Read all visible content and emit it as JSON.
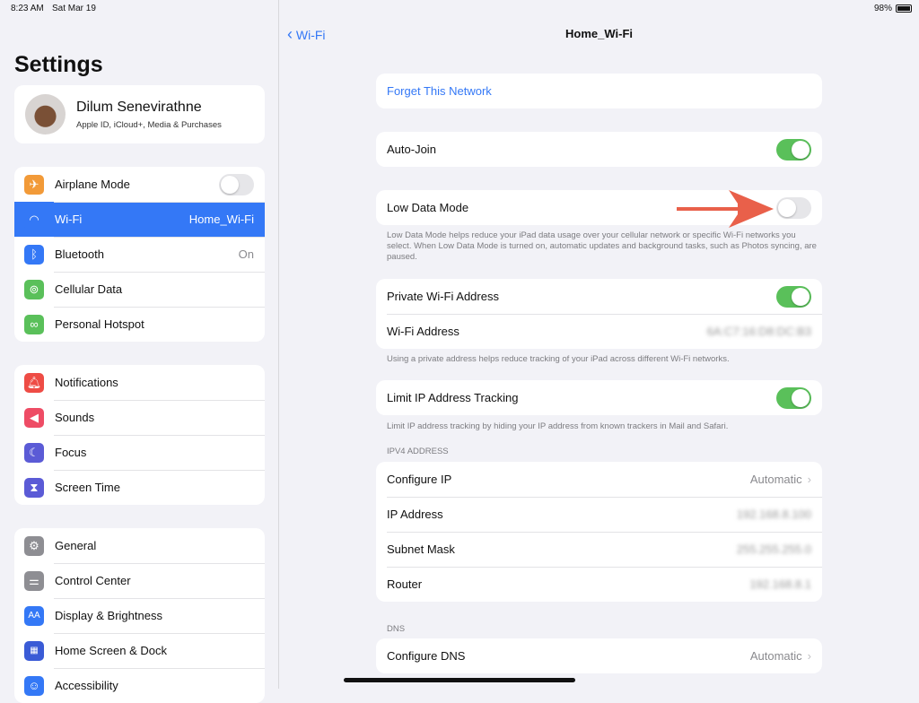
{
  "status": {
    "time": "8:23 AM",
    "date": "Sat Mar 19",
    "battery": "98%"
  },
  "sidebar": {
    "title": "Settings",
    "profile": {
      "name": "Dilum Senevirathne",
      "subtitle": "Apple ID, iCloud+, Media & Purchases"
    },
    "groups": [
      [
        {
          "label": "Airplane Mode",
          "icon": "airplane-icon",
          "color": "#f29a38"
        },
        {
          "label": "Wi-Fi",
          "value": "Home_Wi-Fi",
          "icon": "wifi-icon",
          "color": "#3478f6"
        },
        {
          "label": "Bluetooth",
          "value": "On",
          "icon": "bluetooth-icon",
          "color": "#3478f6"
        },
        {
          "label": "Cellular Data",
          "icon": "antenna-icon",
          "color": "#5ac05a"
        },
        {
          "label": "Personal Hotspot",
          "icon": "hotspot-icon",
          "color": "#5ac05a"
        }
      ],
      [
        {
          "label": "Notifications",
          "icon": "bell-icon",
          "color": "#ee4c45"
        },
        {
          "label": "Sounds",
          "icon": "speaker-icon",
          "color": "#ee4c65"
        },
        {
          "label": "Focus",
          "icon": "moon-icon",
          "color": "#5b5bd6"
        },
        {
          "label": "Screen Time",
          "icon": "hourglass-icon",
          "color": "#5b5bd6"
        }
      ],
      [
        {
          "label": "General",
          "icon": "gear-icon",
          "color": "#8e8e93"
        },
        {
          "label": "Control Center",
          "icon": "switches-icon",
          "color": "#8e8e93"
        },
        {
          "label": "Display & Brightness",
          "icon": "aa-icon",
          "color": "#3478f6"
        },
        {
          "label": "Home Screen & Dock",
          "icon": "grid-icon",
          "color": "#3a5bd6"
        },
        {
          "label": "Accessibility",
          "icon": "accessibility-icon",
          "color": "#3478f6"
        }
      ]
    ]
  },
  "detail": {
    "back": "Wi-Fi",
    "title": "Home_Wi-Fi",
    "forget": "Forget This Network",
    "auto_join": "Auto-Join",
    "low_data": "Low Data Mode",
    "low_data_footer": "Low Data Mode helps reduce your iPad data usage over your cellular network or specific Wi-Fi networks you select. When Low Data Mode is turned on, automatic updates and background tasks, such as Photos syncing, are paused.",
    "private_addr": "Private Wi-Fi Address",
    "wifi_addr": "Wi-Fi Address",
    "wifi_addr_value": "6A:C7:16:D8:DC:B3",
    "private_footer": "Using a private address helps reduce tracking of your iPad across different Wi-Fi networks.",
    "limit_ip": "Limit IP Address Tracking",
    "limit_footer": "Limit IP address tracking by hiding your IP address from known trackers in Mail and Safari.",
    "ipv4_header": "IPV4 ADDRESS",
    "configure_ip": "Configure IP",
    "configure_ip_value": "Automatic",
    "ip": "IP Address",
    "ip_value": "192.168.8.100",
    "subnet": "Subnet Mask",
    "subnet_value": "255.255.255.0",
    "router": "Router",
    "router_value": "192.168.8.1",
    "dns_header": "DNS",
    "configure_dns": "Configure DNS",
    "configure_dns_value": "Automatic"
  }
}
